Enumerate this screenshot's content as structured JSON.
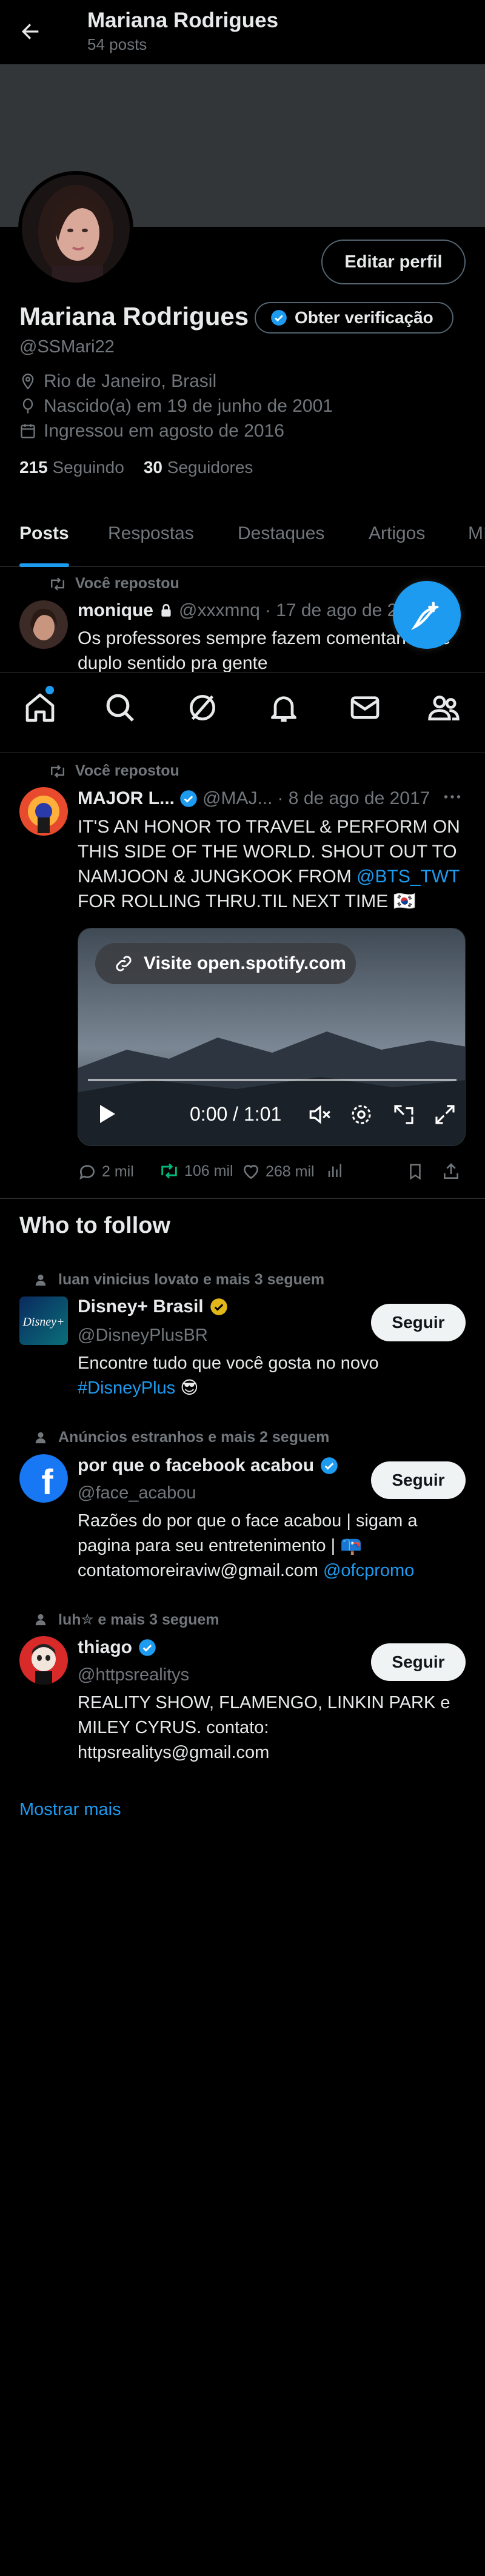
{
  "header": {
    "title": "Mariana Rodrigues",
    "post_count": "54 posts"
  },
  "profile": {
    "edit_button": "Editar perfil",
    "name": "Mariana Rodrigues",
    "verify_button": "Obter verificação",
    "handle": "@SSMari22",
    "location": "Rio de Janeiro, Brasil",
    "birthday": "Nascido(a) em 19 de junho de 2001",
    "joined": "Ingressou em agosto de 2016",
    "following_count": "215",
    "following_label": "Seguindo",
    "followers_count": "30",
    "followers_label": "Seguidores"
  },
  "tabs": [
    "Posts",
    "Respostas",
    "Destaques",
    "Artigos",
    "Mí"
  ],
  "post1": {
    "repost_label": "Você repostou",
    "name": "monique",
    "handle": "@xxxmnq",
    "date": "· 17 de ago de 2",
    "text_line1": "Os professores sempre fazem comentarios de",
    "text_line2": "duplo sentido pra gente"
  },
  "post2": {
    "repost_label": "Você repostou",
    "name": "MAJOR L...",
    "handle": "@MAJ...",
    "date": "· 8 de ago de 2017",
    "text_line1": "IT'S AN HONOR TO TRAVEL & PERFORM ON",
    "text_line2": "THIS SIDE OF THE WORLD. SHOUT OUT TO",
    "text_line3_a": "NAMJOON & JUNGKOOK FROM ",
    "text_line3_mention": "@BTS_TWT",
    "text_line4": "FOR ROLLING THRU.TIL NEXT TIME 🇰🇷",
    "video_link": "Visite open.spotify.com",
    "video_time": "0:00 / 1:01",
    "replies": "2 mil",
    "reposts": "106 mil",
    "likes": "268 mil"
  },
  "who_to_follow": {
    "title": "Who to follow",
    "follow_label": "Seguir",
    "show_more": "Mostrar mais",
    "suggestions": [
      {
        "social": "luan vinicius lovato e mais 3 seguem",
        "name": "Disney+ Brasil",
        "handle": "@DisneyPlusBR",
        "bio_line1": "Encontre tudo que você gosta no novo",
        "bio_hashtag": "#DisneyPlus",
        "bio_emoji": "😎"
      },
      {
        "social": "Anúncios estranhos e mais 2 seguem",
        "name": "por que o facebook acabou",
        "handle": "@face_acabou",
        "bio_line1": "Razões do por que o face acabou | sigam a",
        "bio_line2": "pagina para seu entretenimento | 📪",
        "bio_line3": "contatomoreiraviw@gmail.com",
        "bio_mention": "@ofcpromo"
      },
      {
        "social": "luh✮ e mais 3 seguem",
        "name": "thiago",
        "handle": "@httpsrealitys",
        "bio_line1": "REALITY SHOW, FLAMENGO, LINKIN PARK e",
        "bio_line2": "MILEY CYRUS. contato:",
        "bio_line3": "httpsrealitys@gmail.com"
      }
    ]
  },
  "colors": {
    "accent": "#1d9bf0",
    "repost_green": "#00ba7c",
    "background": "#000000",
    "muted": "#71767b",
    "verified_gold": "#e2b719"
  }
}
